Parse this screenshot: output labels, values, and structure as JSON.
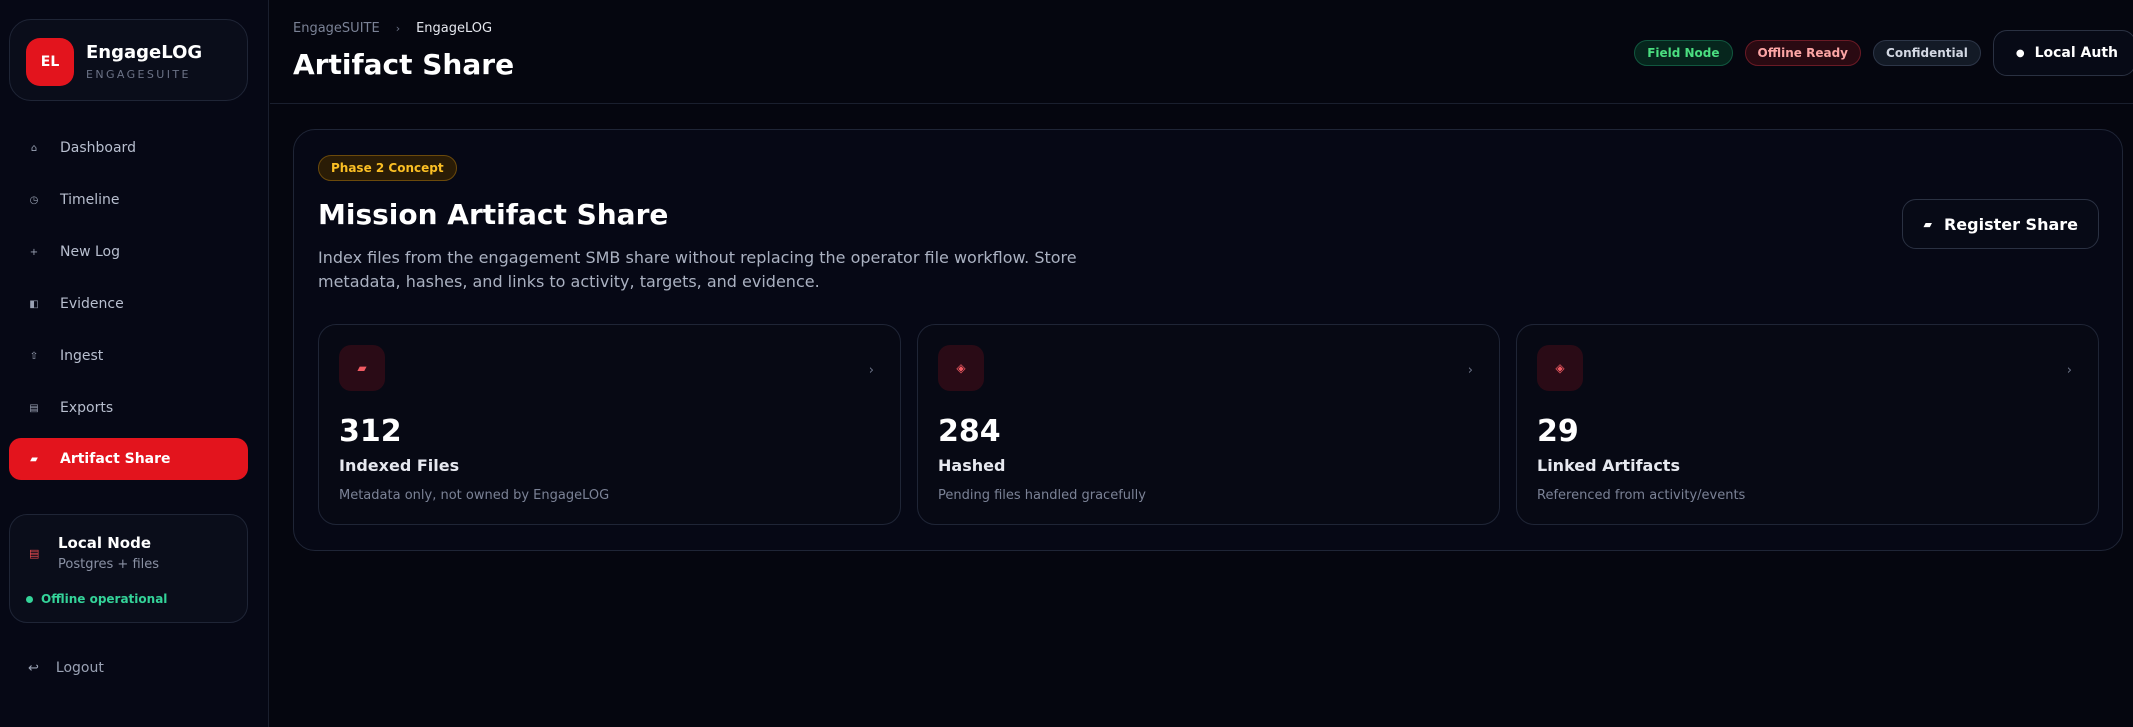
{
  "brand": {
    "logo_text": "EL",
    "name": "EngageLOG",
    "subtitle": "ENGAGESUITE"
  },
  "sidebar": {
    "items": [
      {
        "label": "Dashboard",
        "icon": "home-icon",
        "glyph": "⌂"
      },
      {
        "label": "Timeline",
        "icon": "clock-icon",
        "glyph": "◷"
      },
      {
        "label": "New Log",
        "icon": "plus-icon",
        "glyph": "+"
      },
      {
        "label": "Evidence",
        "icon": "folder-icon",
        "glyph": "◧"
      },
      {
        "label": "Ingest",
        "icon": "upload-icon",
        "glyph": "⇧"
      },
      {
        "label": "Exports",
        "icon": "archive-icon",
        "glyph": "▤"
      },
      {
        "label": "Artifact Share",
        "icon": "share-drive-icon",
        "glyph": "▰",
        "active": true
      }
    ],
    "node": {
      "glyph": "▤",
      "title": "Local Node",
      "subtitle": "Postgres + files",
      "status": "Offline operational",
      "status_color": "#34d399"
    },
    "logout": {
      "label": "Logout",
      "glyph": "↩"
    }
  },
  "header": {
    "breadcrumb": [
      "EngageSUITE",
      "EngageLOG"
    ],
    "breadcrumb_sep": "›",
    "title": "Artifact Share",
    "badges": [
      {
        "label": "Field Node",
        "tone": "green"
      },
      {
        "label": "Offline Ready",
        "tone": "red"
      },
      {
        "label": "Confidential",
        "tone": "gray"
      }
    ],
    "auth": {
      "label": "Local Auth",
      "glyph": "●"
    }
  },
  "main": {
    "phase": "Phase 2 Concept",
    "title": "Mission Artifact Share",
    "description": "Index files from the engagement SMB share without replacing the operator file workflow. Store metadata, hashes, and links to activity, targets, and evidence.",
    "register": {
      "label": "Register Share",
      "glyph": "▰"
    },
    "stats": [
      {
        "value": "312",
        "label": "Indexed Files",
        "sub": "Metadata only, not owned by EngageLOG",
        "glyph": "▰",
        "icon": "file-stack-icon"
      },
      {
        "value": "284",
        "label": "Hashed",
        "sub": "Pending files handled gracefully",
        "glyph": "◈",
        "icon": "hash-icon"
      },
      {
        "value": "29",
        "label": "Linked Artifacts",
        "sub": "Referenced from activity/events",
        "glyph": "◈",
        "icon": "link-icon"
      }
    ],
    "chevron": "›"
  },
  "colors": {
    "accent": "#e3141d",
    "background": "#05060f",
    "warning": "#fbbf24",
    "success": "#34d399"
  }
}
